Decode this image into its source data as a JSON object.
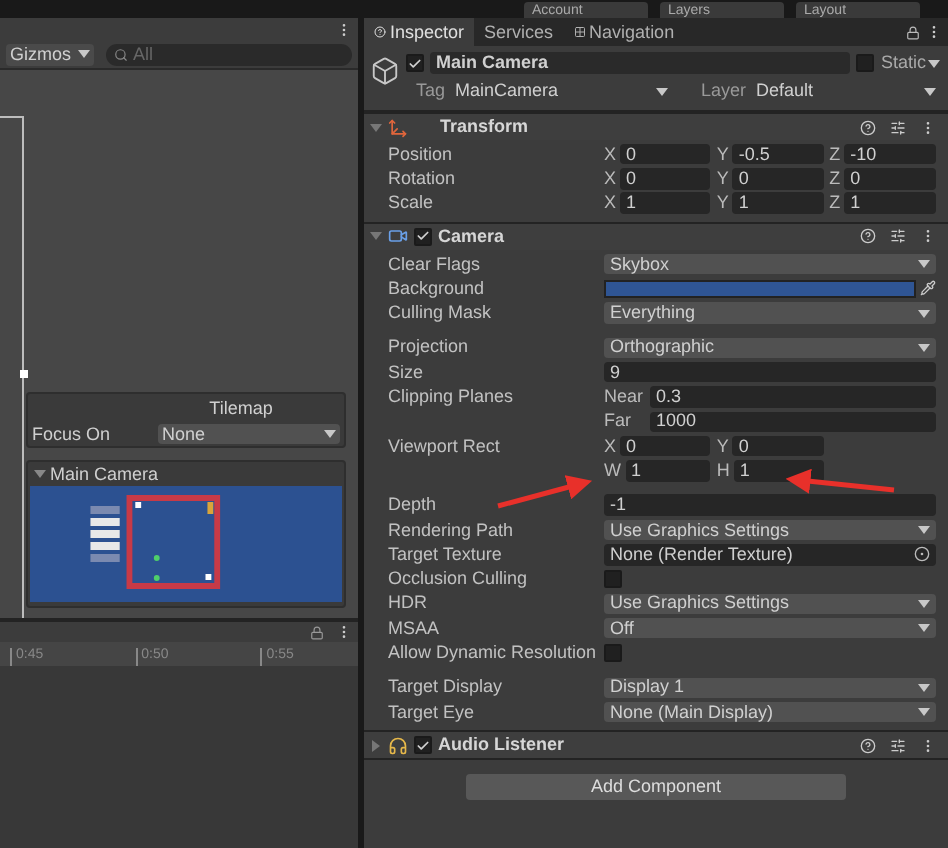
{
  "top_bar": {
    "buttons": [
      "Account",
      "Layers",
      "Layout"
    ]
  },
  "scene": {
    "gizmos": "Gizmos",
    "search": {
      "placeholder": "All"
    },
    "tilemap": {
      "title": "Tilemap",
      "focus_label": "Focus On",
      "focus_value": "None"
    },
    "camera_preview": {
      "title": "Main Camera",
      "expanded": true
    }
  },
  "timeline": {
    "ticks": [
      "0:45",
      "0:50",
      "0:55"
    ]
  },
  "inspector": {
    "tabs": [
      {
        "label": "Inspector",
        "selected": true
      },
      {
        "label": "Services",
        "selected": false
      },
      {
        "label": "Navigation",
        "selected": false
      }
    ],
    "object": {
      "active": true,
      "name": "Main Camera",
      "static_label": "Static",
      "static": false,
      "tag_label": "Tag",
      "tag": "MainCamera",
      "layer_label": "Layer",
      "layer": "Default"
    },
    "components": [
      {
        "kind": "transform",
        "title": "Transform",
        "expanded": true,
        "sections": [
          [
            {
              "kind": "grid",
              "label": "Position",
              "fields": [
                {
                  "axis": "X",
                  "value": "0"
                },
                {
                  "axis": "Y",
                  "value": "-0.5"
                },
                {
                  "axis": "Z",
                  "value": "-10"
                }
              ]
            },
            {
              "kind": "grid",
              "label": "Rotation",
              "fields": [
                {
                  "axis": "X",
                  "value": "0"
                },
                {
                  "axis": "Y",
                  "value": "0"
                },
                {
                  "axis": "Z",
                  "value": "0"
                }
              ]
            },
            {
              "kind": "grid",
              "label": "Scale",
              "fields": [
                {
                  "axis": "X",
                  "value": "1"
                },
                {
                  "axis": "Y",
                  "value": "1"
                },
                {
                  "axis": "Z",
                  "value": "1"
                }
              ]
            }
          ]
        ]
      },
      {
        "kind": "camera",
        "title": "Camera",
        "enabled": true,
        "expanded": true,
        "sections": [
          [
            {
              "kind": "dropdown",
              "label": "Clear Flags",
              "value": "Skybox"
            },
            {
              "kind": "color",
              "label": "Background",
              "color": "#2f5594"
            },
            {
              "kind": "dropdown",
              "label": "Culling Mask",
              "value": "Everything"
            }
          ],
          [
            {
              "kind": "dropdown",
              "label": "Projection",
              "value": "Orthographic"
            },
            {
              "kind": "field",
              "label": "Size",
              "value": "9"
            },
            {
              "kind": "stacked",
              "label": "Clipping Planes",
              "fields": [
                {
                  "axis": "Near",
                  "value": "0.3"
                },
                {
                  "axis": "Far",
                  "value": "1000"
                }
              ]
            },
            {
              "kind": "grid",
              "label": "Viewport Rect",
              "fields": [
                {
                  "axis": "X",
                  "value": "0"
                },
                {
                  "axis": "Y",
                  "value": "0"
                },
                {
                  "axis": "W",
                  "value": "1"
                },
                {
                  "axis": "H",
                  "value": "1"
                }
              ]
            }
          ],
          [
            {
              "kind": "field",
              "label": "Depth",
              "value": "-1"
            },
            {
              "kind": "dropdown",
              "label": "Rendering Path",
              "value": "Use Graphics Settings"
            },
            {
              "kind": "object",
              "label": "Target Texture",
              "value": "None (Render Texture)"
            },
            {
              "kind": "checkbox",
              "label": "Occlusion Culling",
              "checked": false
            },
            {
              "kind": "dropdown",
              "label": "HDR",
              "value": "Use Graphics Settings"
            },
            {
              "kind": "dropdown",
              "label": "MSAA",
              "value": "Off"
            },
            {
              "kind": "checkbox",
              "label": "Allow Dynamic Resolution",
              "checked": false
            }
          ],
          [
            {
              "kind": "dropdown",
              "label": "Target Display",
              "value": "Display 1"
            },
            {
              "kind": "dropdown",
              "label": "Target Eye",
              "value": "None (Main Display)"
            }
          ]
        ]
      },
      {
        "kind": "audio",
        "title": "Audio Listener",
        "enabled": true,
        "expanded": false
      }
    ],
    "add_button": "Add Component"
  }
}
